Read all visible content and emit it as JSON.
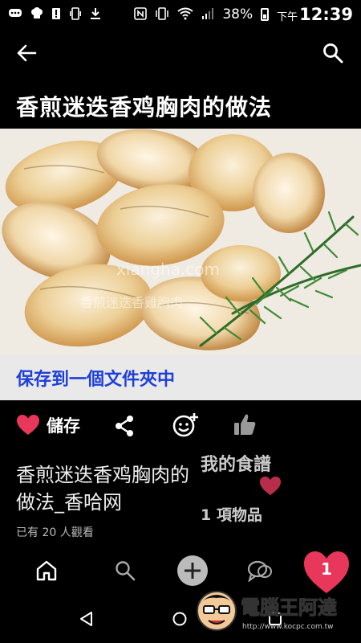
{
  "status_bar": {
    "battery": "38%",
    "ampm": "下午",
    "time": "12:39"
  },
  "recipe": {
    "title": "香煎迷迭香鸡胸肉的做法",
    "image_watermark_url": "xiangha.com",
    "image_watermark_text": "香煎迷迭香雞胸肉"
  },
  "save_to_folder": "保存到一個文件夾中",
  "actions": {
    "save_label": "儲存"
  },
  "description": {
    "title": "香煎迷迭香鸡胸肉的做法_香哈网",
    "views": "已有 20 人觀看"
  },
  "collection": {
    "name": "我的食譜",
    "count": "1 項物品"
  },
  "bottom_nav": {
    "saved_badge": "1"
  },
  "watermark": {
    "brand": "電腦王阿達",
    "url": "http://www.kocpc.com.tw"
  },
  "colors": {
    "accent_red": "#e8375a",
    "link_blue": "#1e3fd8"
  }
}
